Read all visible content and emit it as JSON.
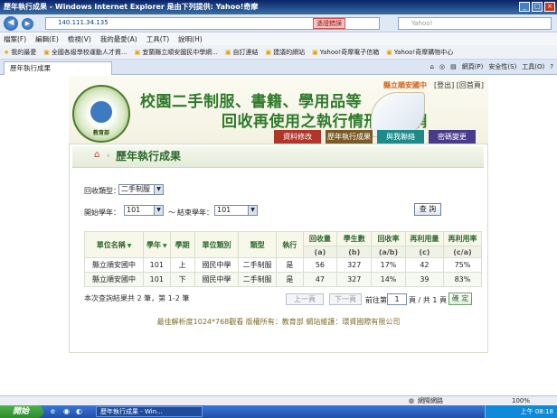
{
  "window": {
    "title": "歷年執行成果 - Windows Internet Explorer 是由下列提供: Yahoo!奇摩"
  },
  "address": {
    "url_host": "140.111.34.135",
    "cert_label": "憑證錯誤",
    "search_placeholder": "Yahoo!"
  },
  "menu": [
    "檔案(F)",
    "編輯(E)",
    "檢視(V)",
    "我的最愛(A)",
    "工具(T)",
    "說明(H)"
  ],
  "favorites": [
    "我的最愛",
    "全國各級學校運動人才資...",
    "宜蘭縣立順安國民中學網...",
    "自訂連結",
    "建議的網站",
    "Yahoo!奇摩電子信箱",
    "Yahoo!奇摩購物中心"
  ],
  "tab": {
    "label": "歷年執行成果"
  },
  "toolbar": {
    "items": [
      "網頁(P)",
      "安全性(S)",
      "工具(O)"
    ]
  },
  "site": {
    "logo_text": "教育部",
    "title_line1": "校園二手制服、書籍、學用品等",
    "title_line2": "回收再使用之執行情形填報網",
    "school_name": "縣立順安國中",
    "logout": "[登出]",
    "home": "[回首頁]"
  },
  "nav": [
    "資料修改",
    "歷年執行成果",
    "與我聯絡",
    "密碼變更"
  ],
  "breadcrumb": {
    "title": "歷年執行成果"
  },
  "filters": {
    "type_label": "回收類型：",
    "type_value": "二手制服",
    "start_label": "開始學年：",
    "start_value": "101",
    "range_sep": "～",
    "end_label": "結束學年：",
    "end_value": "101",
    "search_button": "查 詢"
  },
  "table": {
    "headers": [
      "單位名稱",
      "學年",
      "學期",
      "單位類別",
      "類型",
      "執行",
      "回收量",
      "學生數",
      "回收率",
      "再利用量",
      "再利用率"
    ],
    "subheaders": [
      "(a)",
      "(b)",
      "(a/b)",
      "(c)",
      "(c/a)"
    ],
    "rows": [
      [
        "縣立順安國中",
        "101",
        "上",
        "國民中學",
        "二手制服",
        "是",
        "56",
        "327",
        "17%",
        "42",
        "75%"
      ],
      [
        "縣立順安國中",
        "101",
        "下",
        "國民中學",
        "二手制服",
        "是",
        "47",
        "327",
        "14%",
        "39",
        "83%"
      ]
    ]
  },
  "pager": {
    "summary": "本次查詢結果共 2 筆，第 1-2 筆",
    "prev": "上一頁",
    "next": "下一頁",
    "goto_label": "前往第",
    "page_value": "1",
    "total": "頁 / 共 1 頁",
    "confirm": "確 定"
  },
  "footer": "最佳解析度1024*768觀看 版權所有：教育部 網站維護：環資國際有限公司",
  "status": {
    "zone": "網際網路",
    "zoom": "100%"
  },
  "taskbar": {
    "start": "開始",
    "task": "歷年執行成果 - Win...",
    "clock": "上午 08:18"
  }
}
